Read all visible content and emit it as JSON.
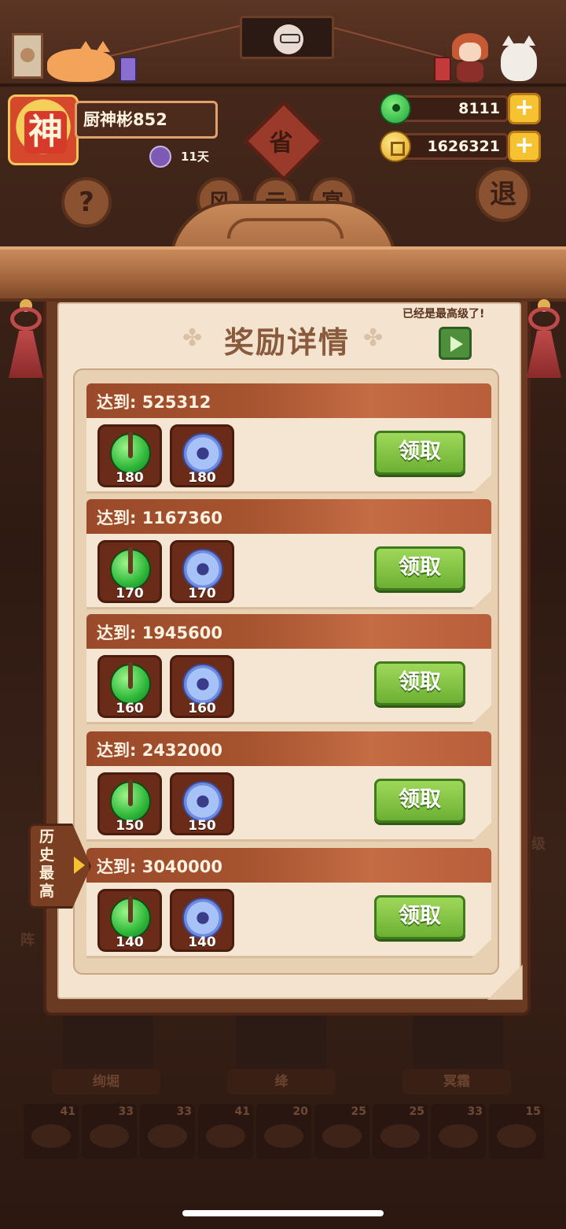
{
  "header": {
    "avatar_char": "神",
    "player_name": "厨神彬852",
    "days": "11天",
    "jade_amount": "8111",
    "coin_amount": "1626321",
    "plus_label": "+"
  },
  "background": {
    "diamond_label": "省",
    "help_label": "?",
    "exit_label": "退",
    "mid_labels": [
      "风",
      "云",
      "宴"
    ],
    "side_right": "级",
    "side_left": "阵"
  },
  "panel": {
    "title": "奖励详情",
    "max_level_text": "已经是最高级了!",
    "history_label": "历史最高"
  },
  "rewards": [
    {
      "reach": "达到: 525312",
      "jade": "180",
      "blue": "180",
      "claim": "领取"
    },
    {
      "reach": "达到: 1167360",
      "jade": "170",
      "blue": "170",
      "claim": "领取"
    },
    {
      "reach": "达到: 1945600",
      "jade": "160",
      "blue": "160",
      "claim": "领取"
    },
    {
      "reach": "达到: 2432000",
      "jade": "150",
      "blue": "150",
      "claim": "领取"
    },
    {
      "reach": "达到: 3040000",
      "jade": "140",
      "blue": "140",
      "claim": "领取"
    }
  ],
  "characters": [
    "绚堀",
    "绛",
    "冥霜"
  ],
  "dishes": [
    "41",
    "33",
    "33",
    "41",
    "20",
    "25",
    "25",
    "33",
    "15"
  ],
  "colors": {
    "claim_green": "#6cb033",
    "card_header": "#a6532f",
    "paper": "#f3e3cf",
    "gold": "#f6c232"
  }
}
